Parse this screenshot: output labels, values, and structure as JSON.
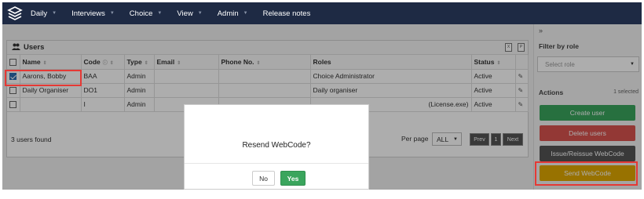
{
  "nav": {
    "items": [
      {
        "label": "Daily",
        "has_menu": true
      },
      {
        "label": "Interviews",
        "has_menu": true
      },
      {
        "label": "Choice",
        "has_menu": true
      },
      {
        "label": "View",
        "has_menu": true
      },
      {
        "label": "Admin",
        "has_menu": true
      },
      {
        "label": "Release notes",
        "has_menu": false
      }
    ]
  },
  "users_panel": {
    "title": "Users",
    "columns": [
      "Name",
      "Code",
      "Type",
      "Email",
      "Phone No.",
      "Roles",
      "Status"
    ],
    "rows": [
      {
        "checked": true,
        "name": "Aarons, Bobby",
        "code": "BAA",
        "type": "Admin",
        "email": "",
        "phone": "",
        "roles": "Choice Administrator",
        "status": "Active"
      },
      {
        "checked": false,
        "name": "Daily Organiser",
        "code": "DO1",
        "type": "Admin",
        "email": "",
        "phone": "",
        "roles": "Daily organiser",
        "status": "Active"
      },
      {
        "checked": false,
        "name": "",
        "code": "I",
        "type": "Admin",
        "email": "",
        "phone": "",
        "roles": "(License.exe)",
        "status": "Active"
      }
    ],
    "footer_count": "3 users found",
    "per_page_label": "Per page",
    "per_page_value": "ALL",
    "pager": {
      "prev": "Prev",
      "page": "1",
      "next": "Next"
    }
  },
  "right_panel": {
    "collapse_glyph": "»",
    "filter_title": "Filter by role",
    "select_placeholder": "Select role",
    "actions_title": "Actions",
    "selected_count": "1 selected",
    "buttons": {
      "create": "Create user",
      "delete": "Delete users",
      "issue": "Issue/Reissue WebCode",
      "send": "Send WebCode"
    }
  },
  "modal": {
    "message": "Resend WebCode?",
    "no_label": "No",
    "yes_label": "Yes"
  },
  "colors": {
    "nav_bg": "#1e2a44",
    "create": "#3aa55d",
    "delete": "#d9534f",
    "issue": "#555555",
    "send": "#e0a800",
    "highlight": "#e53935"
  }
}
